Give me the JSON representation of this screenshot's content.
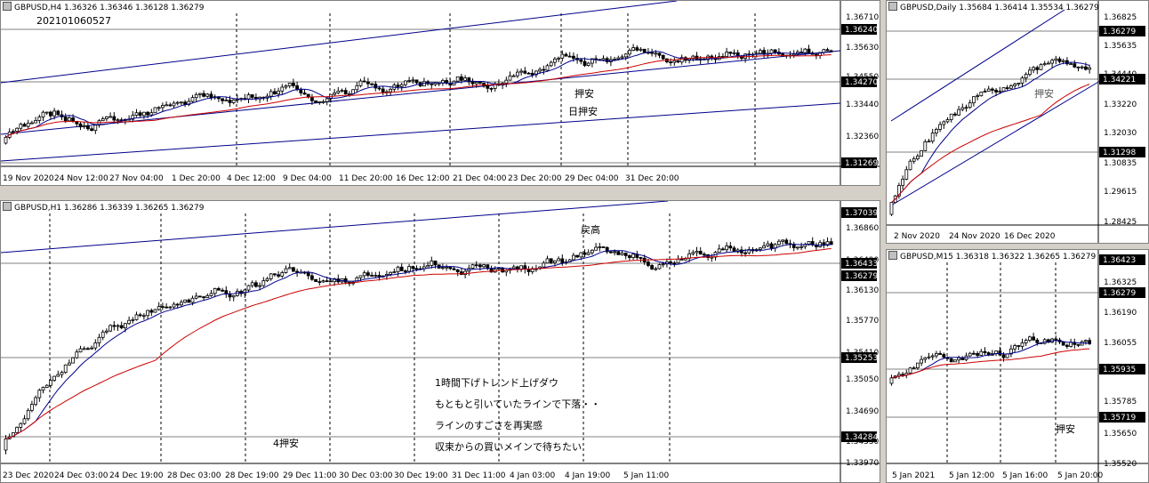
{
  "colors": {
    "candle": "#000000",
    "ma_fast": "#00008b",
    "ma_slow": "#cc0000",
    "magenta": "#cc00cc",
    "cyan": "#00c0c0",
    "green": "#008000",
    "trendline": "#00008b",
    "hline": "#808080",
    "tag_bg": "#000000",
    "tag_fg": "#ffffff"
  },
  "panes": [
    {
      "id": "h4",
      "header": "GBPUSD,H4  1.36326 1.36346 1.36128 1.36279",
      "note": "202101060527",
      "price_labels": [
        "1.36710",
        "1.35630",
        "1.34550",
        "1.33440",
        "1.32360",
        "1.31269"
      ],
      "price_tags": [
        "1.36240",
        "1.34270",
        "1.31269"
      ],
      "time_labels": [
        "19 Nov 2020",
        "24 Nov 12:00",
        "27 Nov 04:00",
        "1 Dec 20:00",
        "4 Dec 12:00",
        "9 Dec 04:00",
        "11 Dec 20:00",
        "16 Dec 12:00",
        "21 Dec 04:00",
        "23 Dec 20:00",
        "29 Dec 04:00",
        "31 Dec 20:00"
      ],
      "annotations": [
        "押安",
        "日押安"
      ]
    },
    {
      "id": "d1",
      "header": "GBPUSD,Daily  1.35684 1.36414 1.35534 1.36279",
      "price_labels": [
        "1.36825",
        "1.35635",
        "1.34440",
        "1.33220",
        "1.32030",
        "1.30835",
        "1.29615",
        "1.28425"
      ],
      "price_tags": [
        "1.36279",
        "1.34221",
        "1.31298"
      ],
      "time_labels": [
        "2 Nov 2020",
        "24 Nov 2020",
        "16 Dec 2020"
      ],
      "annotations": [
        "押安"
      ]
    },
    {
      "id": "h1",
      "header": "GBPUSD,H1  1.36286 1.36339 1.36265 1.36279",
      "price_labels": [
        "1.36860",
        "1.36490",
        "1.36130",
        "1.35770",
        "1.35410",
        "1.35050",
        "1.34690",
        "1.34330",
        "1.33970"
      ],
      "price_tags": [
        "1.37039",
        "1.36433",
        "1.36279",
        "1.35253",
        "1.34284"
      ],
      "time_labels": [
        "23 Dec 2020",
        "24 Dec 03:00",
        "24 Dec 19:00",
        "28 Dec 03:00",
        "28 Dec 19:00",
        "29 Dec 11:00",
        "30 Dec 03:00",
        "30 Dec 19:00",
        "31 Dec 11:00",
        "4 Jan 03:00",
        "4 Jan 19:00",
        "5 Jan 11:00"
      ],
      "annotations": [
        "戻高",
        "4押安"
      ],
      "comments": [
        "1時間下げトレンド上げダウ",
        "もともと引いていたラインで下落・・",
        "ラインのすごさを再実感",
        "収束からの買いメインで待ちたい"
      ]
    },
    {
      "id": "m15",
      "header": "GBPUSD,M15  1.36318 1.36322 1.36265 1.36279",
      "price_labels": [
        "1.36325",
        "1.36190",
        "1.36055",
        "1.35785",
        "1.35650",
        "1.35520"
      ],
      "price_tags": [
        "1.36423",
        "1.36279",
        "1.35935",
        "1.35719"
      ],
      "time_labels": [
        "5 Jan 2021",
        "5 Jan 12:00",
        "5 Jan 16:00",
        "5 Jan 20:00"
      ],
      "annotations": [
        "押安"
      ]
    }
  ]
}
